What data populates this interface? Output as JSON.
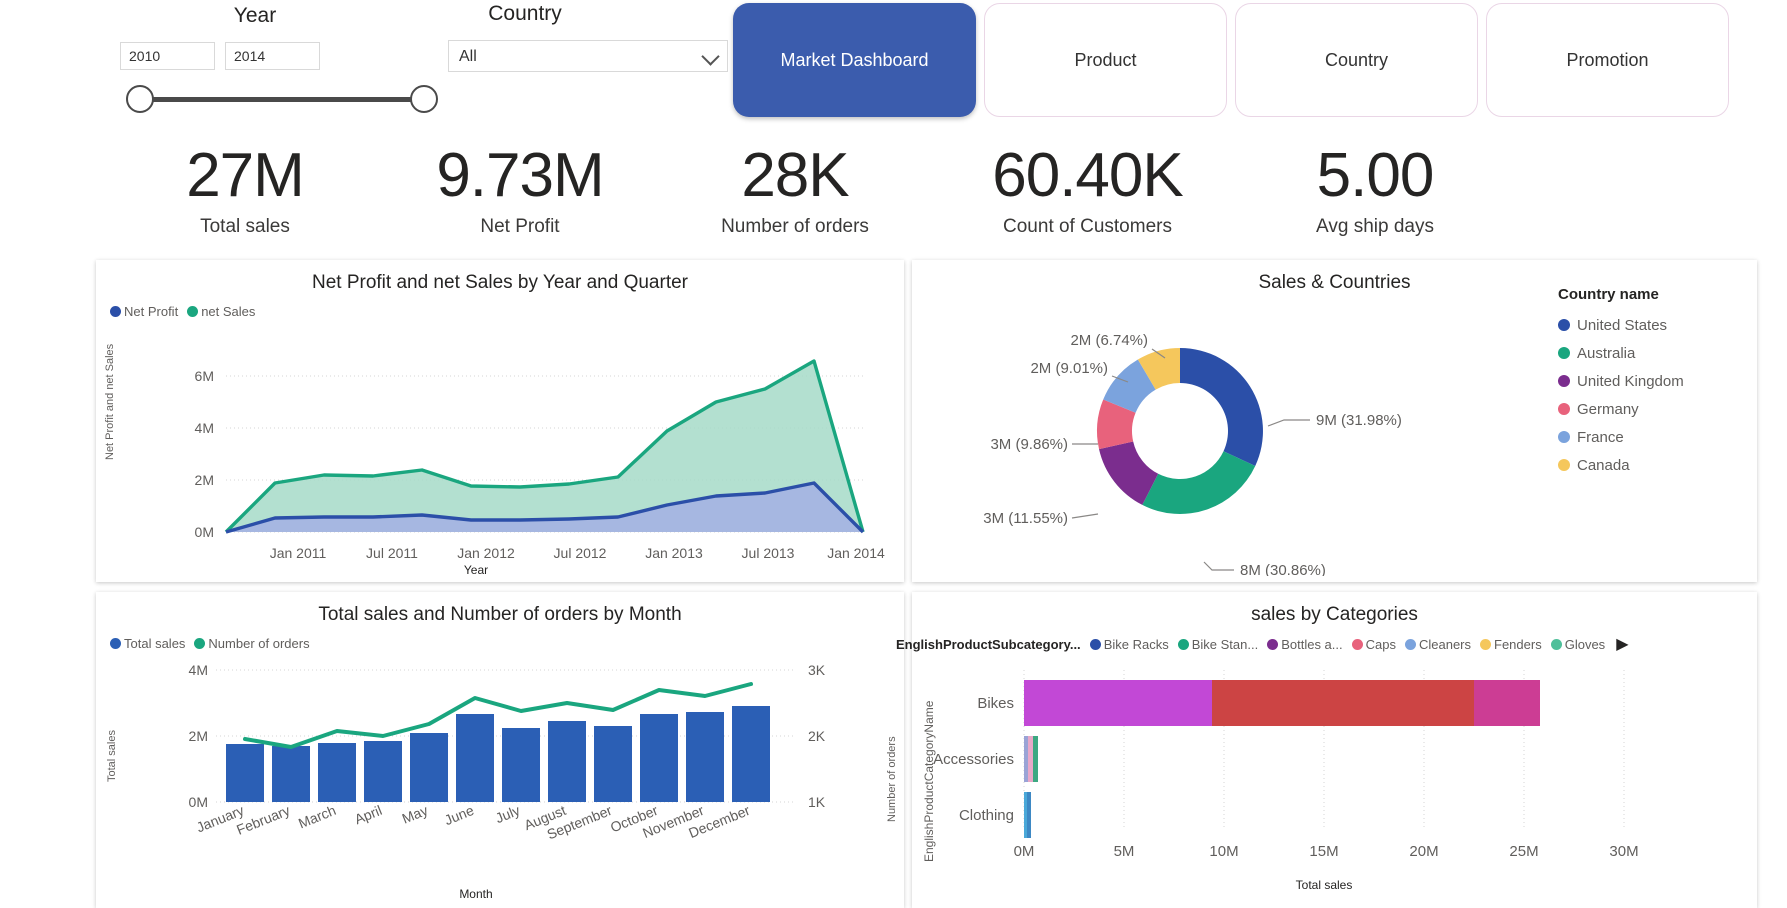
{
  "filters": {
    "year": {
      "title": "Year",
      "from": "2010",
      "to": "2014",
      "from_placeholder": "2010",
      "to_placeholder": "2014"
    },
    "country": {
      "title": "Country",
      "selected": "All",
      "options": [
        "All",
        "United States",
        "Australia",
        "United Kingdom",
        "Germany",
        "France",
        "Canada"
      ]
    }
  },
  "nav": {
    "active_color": "#3b5cad",
    "tabs": [
      {
        "label": "Market Dashboard",
        "active": true
      },
      {
        "label": "Product",
        "active": false
      },
      {
        "label": "Country",
        "active": false
      },
      {
        "label": "Promotion",
        "active": false
      }
    ]
  },
  "kpis": [
    {
      "value": "27M",
      "label": "Total sales"
    },
    {
      "value": "9.73M",
      "label": "Net Profit"
    },
    {
      "value": "28K",
      "label": "Number of orders"
    },
    {
      "value": "60.40K",
      "label": "Count of Customers"
    },
    {
      "value": "5.00",
      "label": "Avg ship days"
    }
  ],
  "chart_data": [
    {
      "id": "area_chart",
      "type": "area",
      "title": "Net Profit and net Sales by Year and Quarter",
      "xlabel": "Year",
      "ylabel": "Net Profit and net Sales",
      "xticks": [
        "Jan 2011",
        "Jul 2011",
        "Jan 2012",
        "Jul 2012",
        "Jan 2013",
        "Jul 2013",
        "Jan 2014"
      ],
      "yticks": [
        "0M",
        "2M",
        "4M",
        "6M"
      ],
      "ylim": [
        0,
        7000000
      ],
      "grid": true,
      "legend_position": "top-left",
      "x": [
        "2010 Q4",
        "2011 Q1",
        "2011 Q2",
        "2011 Q3",
        "2011 Q4",
        "2012 Q1",
        "2012 Q2",
        "2012 Q3",
        "2012 Q4",
        "2013 Q1",
        "2013 Q2",
        "2013 Q3",
        "2013 Q4",
        "2014 Q1"
      ],
      "series": [
        {
          "name": "net Sales",
          "color": "#1aa67f",
          "fill": "#a6dbc8",
          "values": [
            0,
            1900000,
            2180000,
            2160000,
            2400000,
            1780000,
            1740000,
            1840000,
            2100000,
            3900000,
            5000000,
            5500000,
            6600000,
            0
          ]
        },
        {
          "name": "Net Profit",
          "color": "#2b4fa8",
          "fill": "#a4b3e2",
          "values": [
            0,
            520000,
            580000,
            560000,
            640000,
            480000,
            470000,
            500000,
            560000,
            1050000,
            1380000,
            1500000,
            1880000,
            0
          ]
        }
      ]
    },
    {
      "id": "donut_chart",
      "type": "pie",
      "title": "Sales & Countries",
      "legend_title": "Country name",
      "legend_position": "right",
      "labels": [
        "United States",
        "Australia",
        "United Kingdom",
        "Germany",
        "France",
        "Canada"
      ],
      "data_labels": [
        "9M (31.98%)",
        "8M (30.86%)",
        "3M (11.55%)",
        "3M (9.86%)",
        "2M (9.01%)",
        "2M (6.74%)"
      ],
      "values": [
        31.98,
        30.86,
        11.55,
        9.86,
        9.01,
        6.74
      ],
      "colors": [
        "#2b4fa8",
        "#1aa67f",
        "#7b2d8e",
        "#e8627c",
        "#7ba3dd",
        "#f5c75c"
      ]
    },
    {
      "id": "month_chart",
      "type": "bar",
      "title": "Total sales and Number of orders by Month",
      "xlabel": "Month",
      "ylabel": "Total sales",
      "y2label": "Number of orders",
      "categories": [
        "January",
        "February",
        "March",
        "April",
        "May",
        "June",
        "July",
        "August",
        "September",
        "October",
        "November",
        "December"
      ],
      "yticks": [
        "0M",
        "2M",
        "4M"
      ],
      "y2ticks": [
        "1K",
        "2K",
        "3K"
      ],
      "ylim": [
        0,
        4000000
      ],
      "y2lim": [
        1000,
        3000
      ],
      "grid": true,
      "legend_position": "top-left",
      "series": [
        {
          "name": "Total sales",
          "type": "bar",
          "color": "#2b5fb5",
          "values": [
            1760000,
            1680000,
            1800000,
            1840000,
            2080000,
            2680000,
            2240000,
            2460000,
            2300000,
            2680000,
            2740000,
            2920000
          ]
        },
        {
          "name": "Number of orders",
          "type": "line",
          "color": "#1aa67f",
          "values": [
            1950,
            1840,
            2080,
            2000,
            2180,
            2580,
            2380,
            2500,
            2400,
            2700,
            2640,
            2800
          ]
        }
      ]
    },
    {
      "id": "categories_chart",
      "type": "bar",
      "orientation": "horizontal",
      "stacked": true,
      "title": "sales by Categories",
      "xlabel": "Total sales",
      "ylabel": "EnglishProductCategoryName",
      "legend_title": "EnglishProductSubcategory...",
      "legend_has_more": true,
      "xticks": [
        "0M",
        "5M",
        "10M",
        "15M",
        "20M",
        "25M",
        "30M"
      ],
      "xlim": [
        0,
        30000000
      ],
      "categories": [
        "Bikes",
        "Accessories",
        "Clothing"
      ],
      "legend_items": [
        {
          "label": "Bike Racks",
          "color": "#2b4fa8"
        },
        {
          "label": "Bike Stan...",
          "color": "#1aa67f"
        },
        {
          "label": "Bottles a...",
          "color": "#7b2d8e"
        },
        {
          "label": "Caps",
          "color": "#e8627c"
        },
        {
          "label": "Cleaners",
          "color": "#7ba3dd"
        },
        {
          "label": "Fenders",
          "color": "#f5c75c"
        },
        {
          "label": "Gloves",
          "color": "#4fbf9a"
        }
      ],
      "rows": [
        {
          "category": "Bikes",
          "total": 25800000,
          "segments": [
            {
              "value": 9400000,
              "color": "#c248d6"
            },
            {
              "value": 13100000,
              "color": "#cc4444"
            },
            {
              "value": 3300000,
              "color": "#cc3d94"
            }
          ]
        },
        {
          "category": "Accessories",
          "total": 700000,
          "segments": [
            {
              "value": 180000,
              "color": "#9aa3d6"
            },
            {
              "value": 250000,
              "color": "#e8a8c8"
            },
            {
              "value": 270000,
              "color": "#3da882"
            }
          ]
        },
        {
          "category": "Clothing",
          "total": 340000,
          "segments": [
            {
              "value": 160000,
              "color": "#4aa8d8"
            },
            {
              "value": 180000,
              "color": "#3d88c4"
            }
          ]
        }
      ]
    }
  ]
}
